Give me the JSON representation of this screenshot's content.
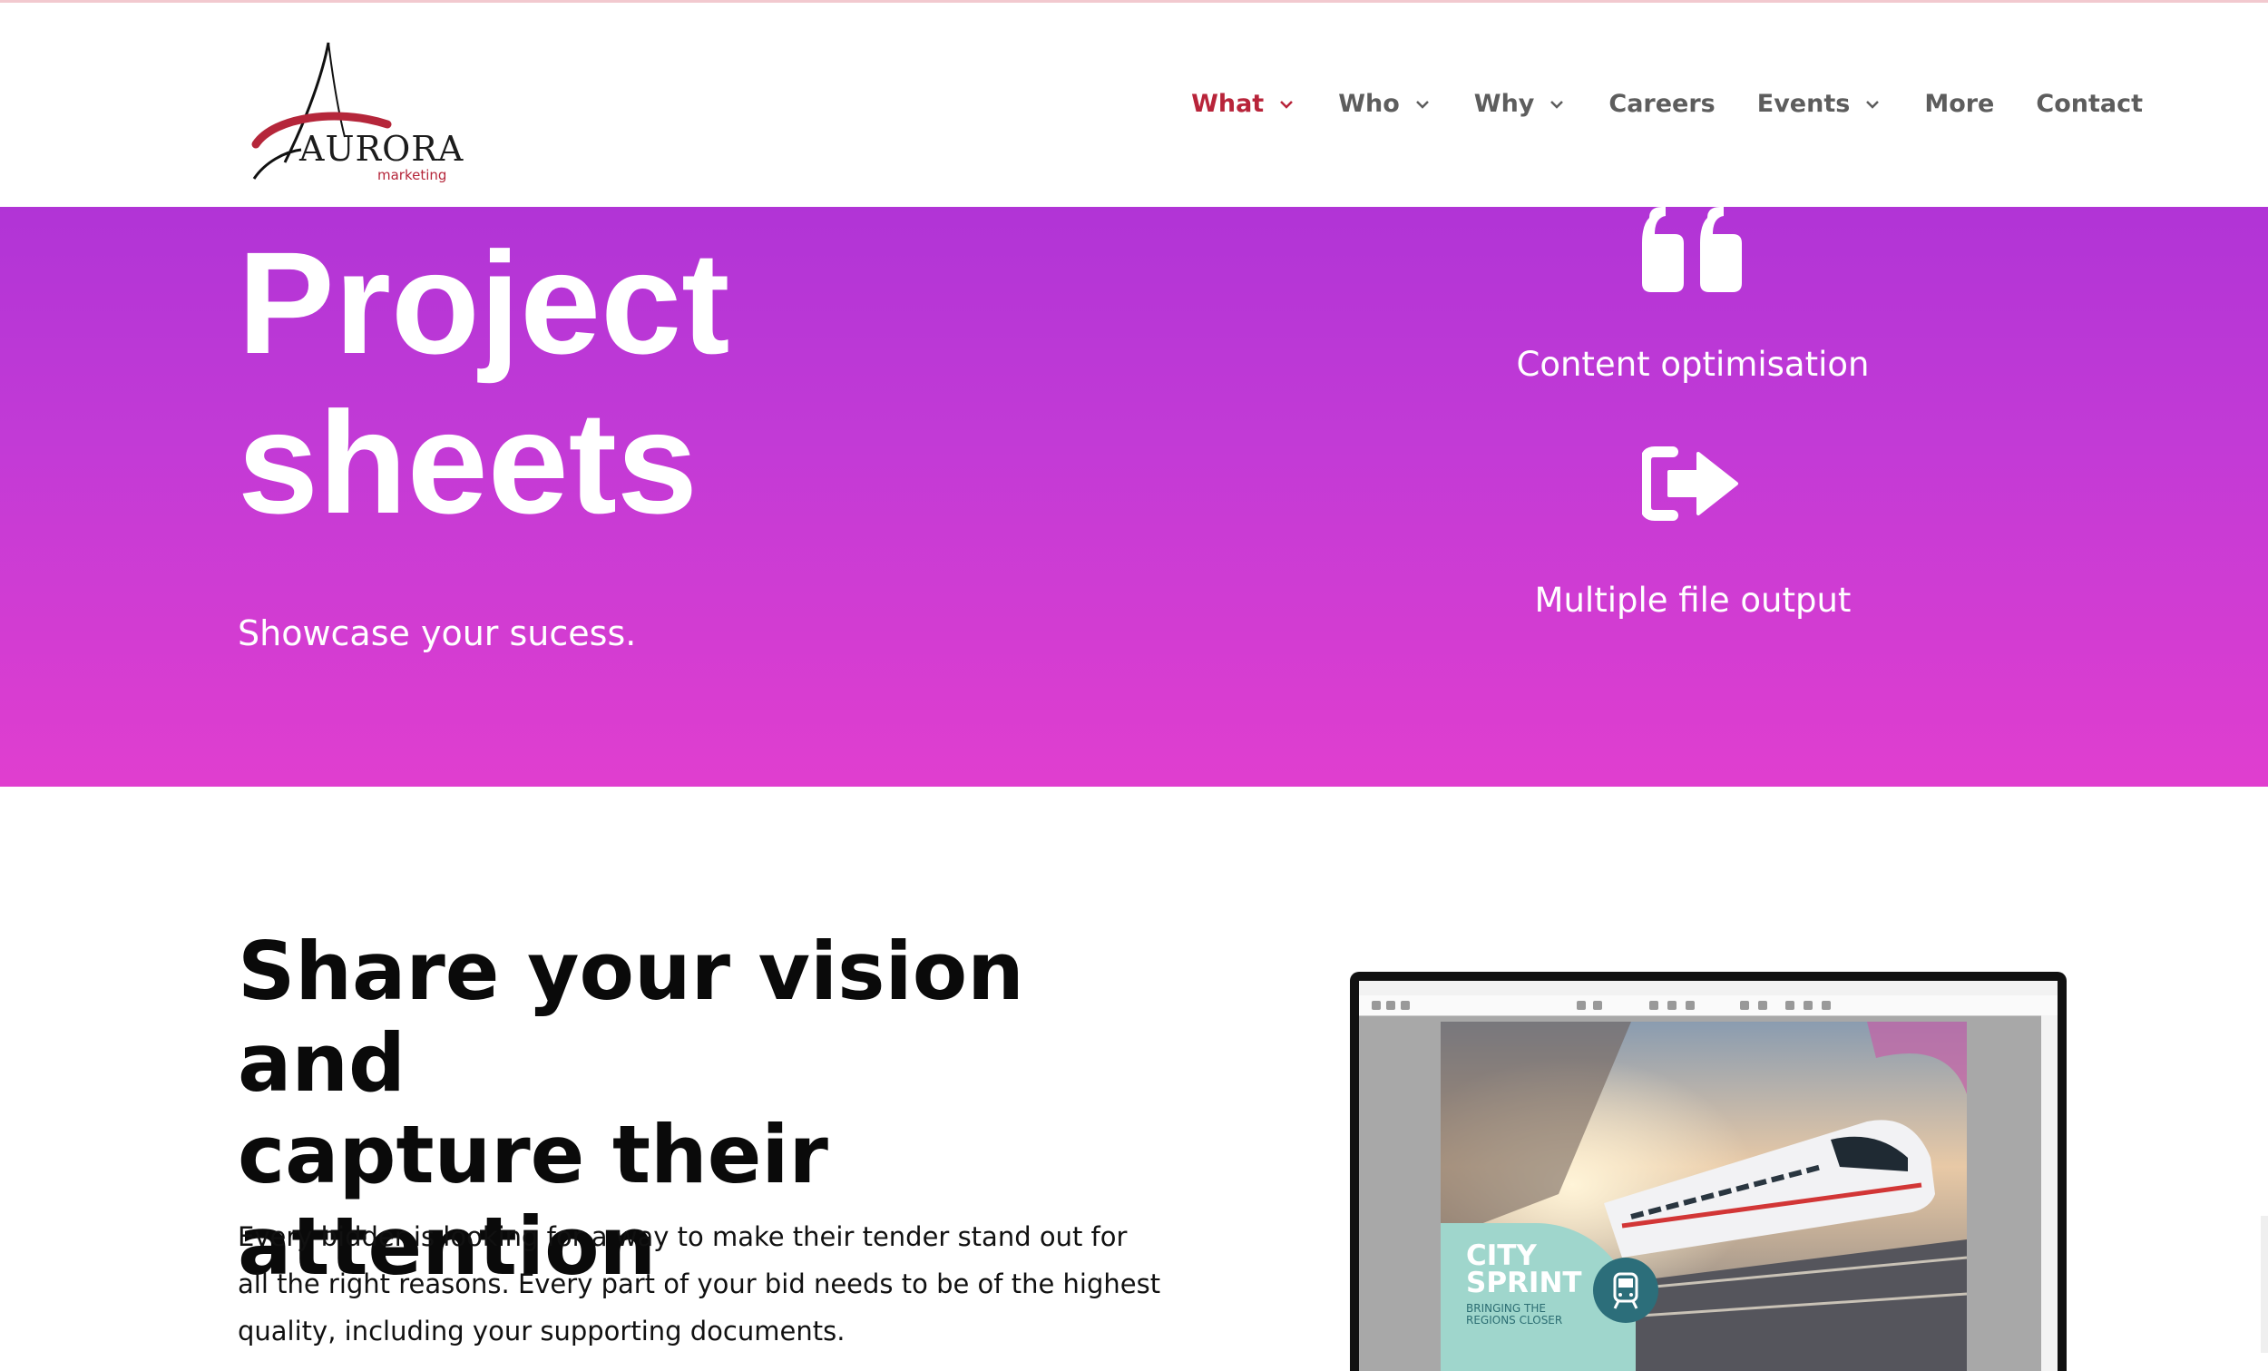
{
  "brand": {
    "name": "AURORA",
    "tagline": "marketing"
  },
  "nav": {
    "items": [
      {
        "label": "What",
        "dropdown": true,
        "active": true
      },
      {
        "label": "Who",
        "dropdown": true,
        "active": false
      },
      {
        "label": "Why",
        "dropdown": true,
        "active": false
      },
      {
        "label": "Careers",
        "dropdown": false,
        "active": false
      },
      {
        "label": "Events",
        "dropdown": true,
        "active": false
      },
      {
        "label": "More",
        "dropdown": false,
        "active": false
      },
      {
        "label": "Contact",
        "dropdown": false,
        "active": false
      }
    ]
  },
  "hero": {
    "title_line1": "Project",
    "title_line2": "sheets",
    "subtitle": "Showcase your sucess.",
    "features": [
      {
        "icon": "quote-icon",
        "label": "Content optimisation"
      },
      {
        "icon": "sign-out-arrow-icon",
        "label": "Multiple file output"
      }
    ]
  },
  "content": {
    "heading_line1": "Share your vision and",
    "heading_line2": "capture their",
    "heading_line3": "attention",
    "body_line1": "Every bidder is looking for a way to make their tender stand out for",
    "body_line2": "all the right reasons. Every part of your bid needs to be of the highest",
    "body_line3": "quality, including your supporting documents."
  },
  "mockup": {
    "badge_title_line1": "CITY",
    "badge_title_line2": "SPRINT",
    "badge_sub_line1": "BRINGING THE",
    "badge_sub_line2": "REGIONS CLOSER"
  },
  "colors": {
    "accent": "#b8243a",
    "hero_top": "#b134d6",
    "hero_bottom": "#e03ecf",
    "nav_text": "#5d5d5d"
  }
}
